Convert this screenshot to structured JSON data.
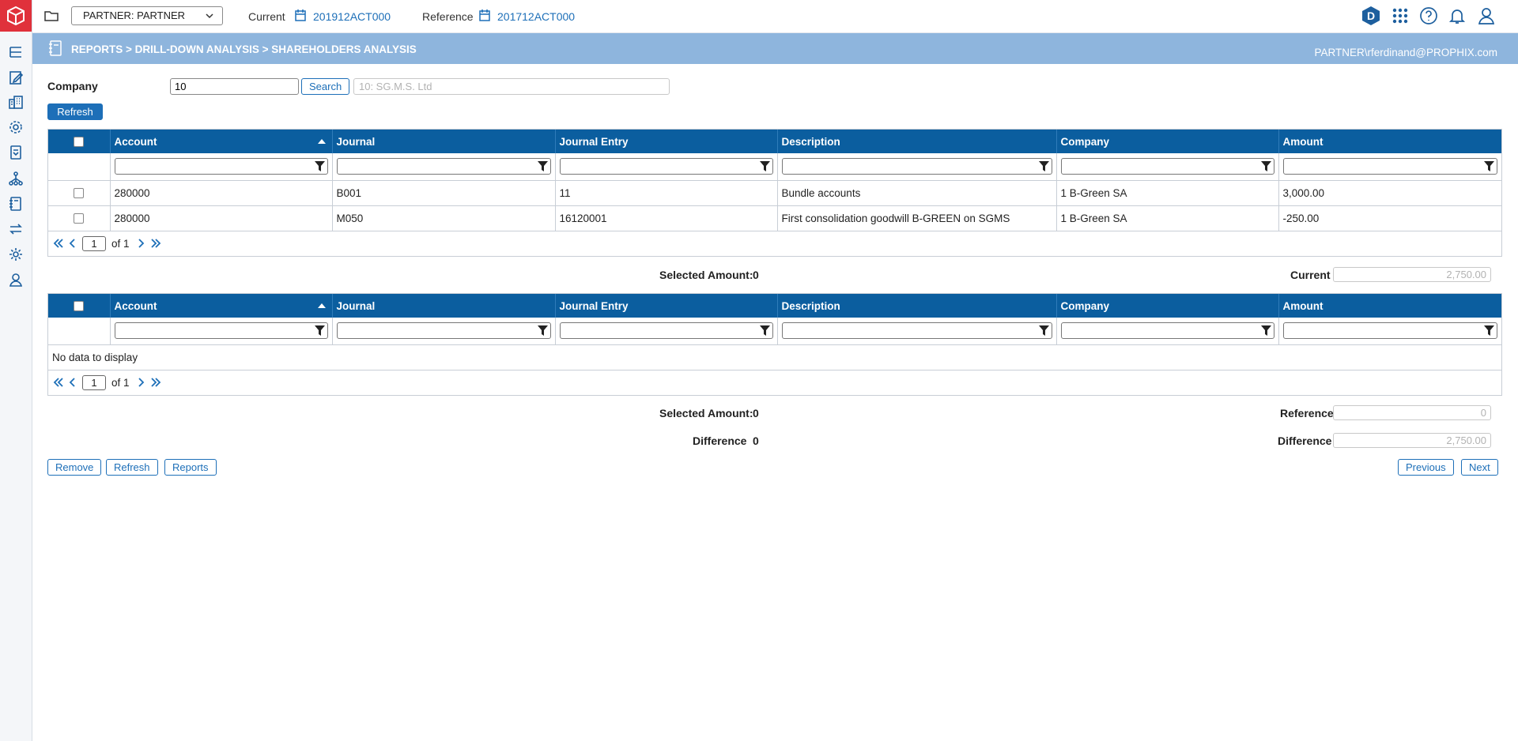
{
  "topbar": {
    "partner_select": "PARTNER: PARTNER",
    "current_label": "Current",
    "current_value": "201912ACT000",
    "reference_label": "Reference",
    "reference_value": "201712ACT000",
    "badge_letter": "D"
  },
  "banner": {
    "breadcrumb": "REPORTS > DRILL-DOWN ANALYSIS > SHAREHOLDERS ANALYSIS",
    "user": "PARTNER\\rferdinand@PROPHIX.com"
  },
  "company": {
    "label": "Company",
    "value": "10",
    "search_label": "Search",
    "description": "10: SG.M.S. Ltd",
    "refresh_label": "Refresh"
  },
  "columns": [
    "Account",
    "Journal",
    "Journal Entry",
    "Description",
    "Company",
    "Amount"
  ],
  "grid1": {
    "rows": [
      {
        "account": "280000",
        "journal": "B001",
        "entry": "11",
        "description": "Bundle accounts",
        "company": "1 B-Green SA",
        "amount": "3,000.00"
      },
      {
        "account": "280000",
        "journal": "M050",
        "entry": "16120001",
        "description": "First consolidation goodwill B-GREEN on SGMS",
        "company": "1 B-Green SA",
        "amount": "-250.00"
      }
    ],
    "page": "1",
    "of_text": "of",
    "total_pages": "1"
  },
  "summary1": {
    "selected_label": "Selected Amount:",
    "selected_value": "0",
    "current_label": "Current",
    "current_value": "2,750.00"
  },
  "grid2": {
    "no_data": "No data to display",
    "page": "1",
    "of_text": "of",
    "total_pages": "1"
  },
  "summary2": {
    "selected_label": "Selected Amount:",
    "selected_value": "0",
    "reference_label": "Reference",
    "reference_value": "0",
    "difference_label": "Difference",
    "difference_value": "0",
    "difference_right_label": "Difference",
    "difference_right_value": "2,750.00"
  },
  "actions": {
    "remove": "Remove",
    "refresh": "Refresh",
    "reports": "Reports",
    "previous": "Previous",
    "next": "Next"
  },
  "colors": {
    "brand_red": "#e0313b",
    "header_blue": "#0b5e9f",
    "banner_blue": "#8eb5dd",
    "link_blue": "#1d6fb8"
  }
}
